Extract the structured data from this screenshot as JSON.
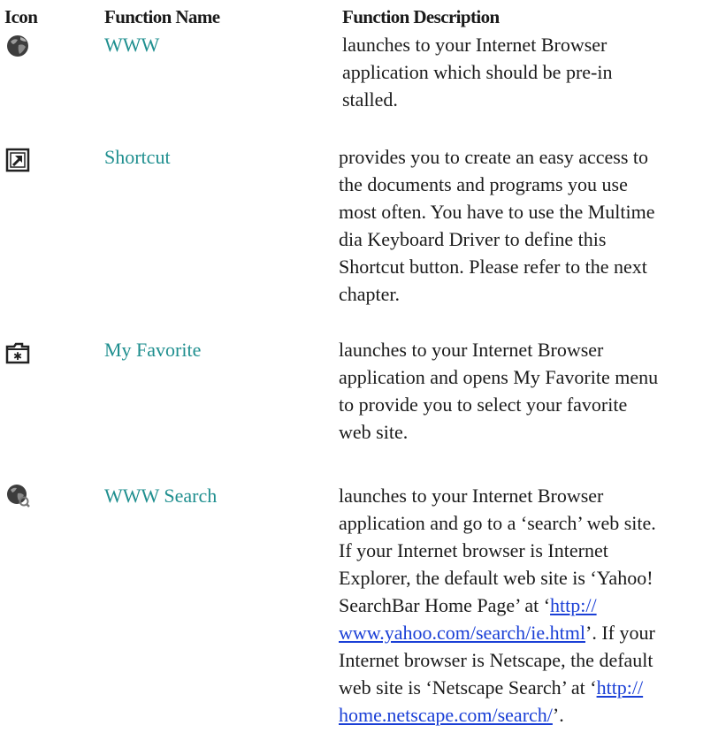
{
  "headers": {
    "icon": "Icon",
    "function_name": "Function Name",
    "function_description": "Function Description"
  },
  "colors": {
    "name_text": "#1f8f8f",
    "body_text": "#1a1a1a",
    "link": "#1a3fd6"
  },
  "rows": [
    {
      "icon": "globe-icon",
      "name": "WWW",
      "description": "launches to your Internet Browser\napplication which should be pre-in\nstalled."
    },
    {
      "icon": "shortcut-arrow-icon",
      "name": "Shortcut",
      "description": "provides you to create an easy access to\nthe documents and programs you use\nmost often. You have to use the Multime\ndia Keyboard Driver to define this\nShortcut button. Please refer to the next\nchapter."
    },
    {
      "icon": "favorite-folder-icon",
      "name": "My Favorite",
      "description": "launches to your Internet Browser\napplication and opens My Favorite menu\nto provide you to select your favorite\nweb site."
    },
    {
      "icon": "globe-search-icon",
      "name": "WWW Search",
      "description": {
        "text_1": "launches to your Internet Browser\napplication and go to a ‘search’ web site.\nIf your Internet browser is Internet\nExplorer, the default web site is ‘Yahoo!\nSearchBar Home Page’ at ‘",
        "link_1": "http://\nwww.yahoo.com/search/ie.html",
        "text_2": "’. If your\nInternet browser is Netscape, the default\nweb site is ‘Netscape Search’ at ‘",
        "link_2": "http://\nhome.netscape.com/search/",
        "text_3": "’."
      }
    }
  ]
}
